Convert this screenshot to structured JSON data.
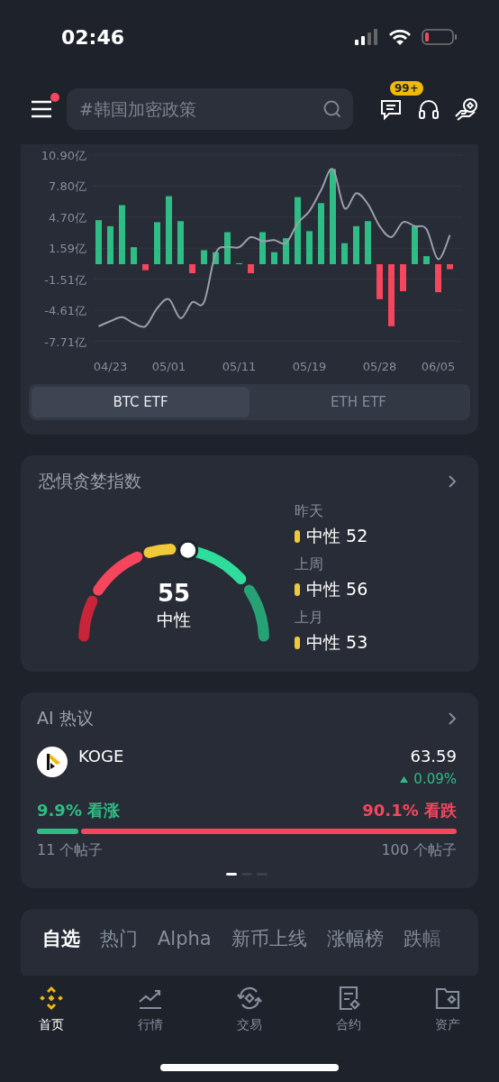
{
  "status_bar": {
    "time": "02:46"
  },
  "header": {
    "menu_badge": true,
    "search": {
      "placeholder": "#韩国加密政策"
    },
    "messages_badge": "99+"
  },
  "etf_card": {
    "chart_data": {
      "type": "bar",
      "categories": [
        null,
        "04/23",
        null,
        null,
        null,
        null,
        "05/01",
        null,
        null,
        null,
        null,
        null,
        "05/11",
        null,
        null,
        null,
        null,
        null,
        "05/19",
        null,
        null,
        null,
        null,
        null,
        "05/28",
        null,
        null,
        null,
        null,
        "06/05",
        null
      ],
      "yticks": [
        {
          "value": 10.9,
          "label": "10.90亿"
        },
        {
          "value": 7.8,
          "label": "7.80亿"
        },
        {
          "value": 4.7,
          "label": "4.70亿"
        },
        {
          "value": 1.59,
          "label": "1.59亿"
        },
        {
          "value": -1.51,
          "label": "-1.51亿"
        },
        {
          "value": -4.61,
          "label": "-4.61亿"
        },
        {
          "value": -7.71,
          "label": "-7.71亿"
        }
      ],
      "ylim": [
        -7.71,
        10.9
      ],
      "grid": true,
      "stacked": true,
      "series": [
        {
          "type": "bar",
          "color": "#2ebd85",
          "values": [
            4.4,
            3.8,
            5.9,
            1.7,
            null,
            4.2,
            6.8,
            4.3,
            null,
            1.4,
            1.2,
            3.2,
            0.1,
            null,
            3.2,
            1.2,
            2.6,
            6.7,
            3.3,
            6.1,
            9.5,
            2.1,
            3.8,
            4.3,
            null,
            null,
            null,
            3.8,
            0.8,
            null,
            null
          ]
        },
        {
          "type": "bar",
          "color": "#f6465d",
          "values": [
            null,
            null,
            null,
            null,
            -0.6,
            null,
            null,
            null,
            -0.9,
            null,
            null,
            null,
            null,
            -0.9,
            null,
            null,
            null,
            null,
            null,
            null,
            null,
            null,
            null,
            null,
            -3.5,
            -6.2,
            -2.7,
            null,
            null,
            -2.8,
            -0.5
          ]
        },
        {
          "type": "line",
          "color": "#9aa0aa",
          "values": [
            -6.2,
            -5.7,
            -5.3,
            -5.9,
            -6.2,
            -4.4,
            -3.5,
            -5.4,
            -3.8,
            -3.8,
            1.1,
            1.7,
            1.7,
            2.7,
            2.3,
            2.4,
            2.1,
            4.1,
            5.3,
            7.4,
            9.5,
            5.6,
            7.1,
            6.0,
            3.8,
            2.7,
            4.2,
            3.8,
            3.5,
            0.5,
            2.9
          ]
        }
      ]
    },
    "tabs": [
      {
        "label": "BTC ETF",
        "selected": true
      },
      {
        "label": "ETH ETF",
        "selected": false
      }
    ]
  },
  "fear_greed": {
    "title": "恐惧贪婪指数",
    "value": "55",
    "label": "中性",
    "history": [
      {
        "period": "昨天",
        "label": "中性 52",
        "color": "#f0c93a"
      },
      {
        "period": "上周",
        "label": "中性 56",
        "color": "#f0c93a"
      },
      {
        "period": "上月",
        "label": "中性 53",
        "color": "#f0c93a"
      }
    ]
  },
  "ai_topics": {
    "title": "AI 热议",
    "coin": {
      "symbol": "KOGE",
      "price": "63.59",
      "change": "0.09%"
    },
    "bullish": "9.9% 看涨",
    "bearish": "90.1% 看跌",
    "level": 0.099,
    "bullish_posts": "11 个帖子",
    "bearish_posts": "100 个帖子",
    "pages": [
      {
        "selected": true
      },
      {
        "selected": false
      },
      {
        "selected": false
      }
    ]
  },
  "market_tabs": [
    {
      "label": "自选",
      "selected": true
    },
    {
      "label": "热门",
      "selected": false
    },
    {
      "label": "Alpha",
      "selected": false
    },
    {
      "label": "新币上线",
      "selected": false
    },
    {
      "label": "涨幅榜",
      "selected": false
    },
    {
      "label": "跌幅",
      "selected": false
    }
  ],
  "bottom_nav": [
    {
      "kind": "home",
      "label": "首页",
      "selected": true
    },
    {
      "kind": "markets",
      "label": "行情",
      "selected": false
    },
    {
      "kind": "trade",
      "label": "交易",
      "selected": false
    },
    {
      "kind": "futures",
      "label": "合约",
      "selected": false
    },
    {
      "kind": "assets",
      "label": "资产",
      "selected": false
    }
  ]
}
